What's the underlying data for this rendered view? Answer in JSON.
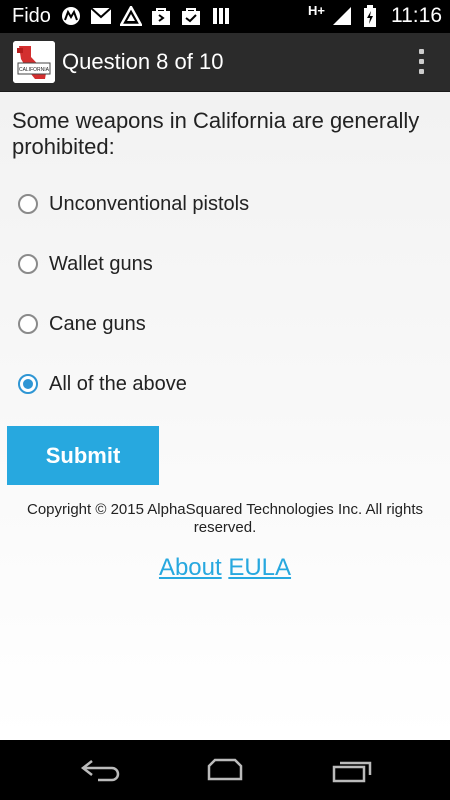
{
  "status_bar": {
    "carrier": "Fido",
    "network": "H+",
    "time": "11:16",
    "icons": [
      "motorola-icon",
      "gmail-icon",
      "app-icon",
      "bag-icon",
      "bag-check-icon",
      "vibrate-icon"
    ]
  },
  "action_bar": {
    "title": "Question 8 of 10",
    "logo_text": "CALIFORNIA FIREARMS TEST"
  },
  "quiz": {
    "question": "Some weapons in California are generally prohibited:",
    "options": [
      {
        "label": "Unconventional pistols",
        "checked": false
      },
      {
        "label": "Wallet guns",
        "checked": false
      },
      {
        "label": "Cane guns",
        "checked": false
      },
      {
        "label": "All of the above",
        "checked": true
      }
    ],
    "submit_label": "Submit"
  },
  "footer": {
    "copyright": "Copyright © 2015 AlphaSquared Technologies Inc. All rights reserved.",
    "about_link": "About",
    "eula_link": "EULA"
  },
  "colors": {
    "accent": "#27a8df",
    "action_bar": "#2b2b2b"
  }
}
